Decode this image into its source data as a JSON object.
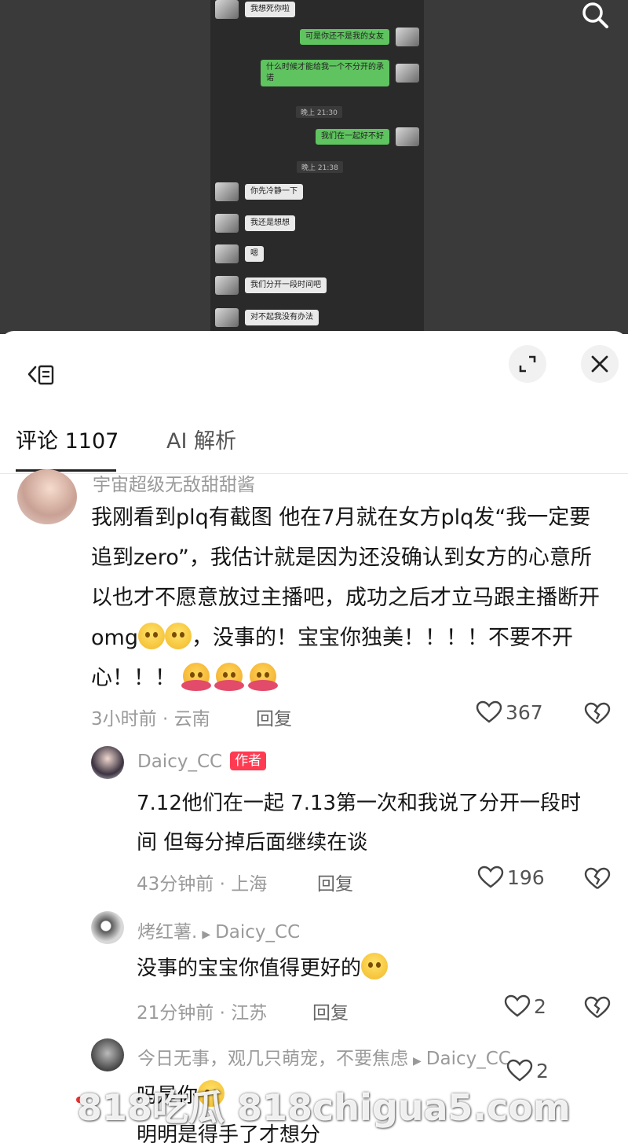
{
  "video": {
    "chat": [
      {
        "side": "left",
        "text": "我想死你啦"
      },
      {
        "side": "right",
        "text": "可是你还不是我的女友"
      },
      {
        "side": "right",
        "text": "什么时候才能给我一个不分开的承诺"
      },
      {
        "system": "晚上 21:30"
      },
      {
        "side": "right",
        "text": "我们在一起好不好"
      },
      {
        "system": "晚上 21:38"
      },
      {
        "side": "left",
        "text": "你先冷静一下"
      },
      {
        "side": "left",
        "text": "我还是想想"
      },
      {
        "side": "left",
        "text": "嗯"
      },
      {
        "side": "left",
        "text": "我们分开一段时间吧"
      },
      {
        "side": "left",
        "text": "对不起我没有办法"
      }
    ]
  },
  "header": {
    "tabs": [
      {
        "label": "评论 1107"
      },
      {
        "label": "AI 解析"
      }
    ]
  },
  "comments": [
    {
      "name": "宇宙超级无敌甜甜酱",
      "text": "我刚看到plq有截图 他在7月就在女方plq发“我一定要追到zero”，我估计就是因为还没确认到女方的心意所以也才不愿意放过主播吧，成功之后才立马跟主播断开omg",
      "text_tail1": "，没事的！宝宝你独美！！！！不要不开心！！！",
      "meta": "3小时前 · 云南",
      "reply": "回复",
      "likes": "367"
    },
    {
      "name": "Daicy_CC",
      "badge": "作者",
      "text": "7.12他们在一起 7.13第一次和我说了分开一段时间 但每分掉后面继续在谈",
      "meta": "43分钟前 · 上海",
      "reply": "回复",
      "likes": "196"
    },
    {
      "name": "烤红薯.",
      "reply_to": "Daicy_CC",
      "text": "没事的宝宝你值得更好的",
      "meta": "21分钟前 · 江苏",
      "reply": "回复",
      "likes": "2"
    },
    {
      "name": "今日无事，观几只萌宠，不要焦虑",
      "reply_to": "Daicy_CC",
      "text_prefix": "吗是你",
      "text": "明明是得手了才想分",
      "likes": "2"
    }
  ],
  "watermark": "818吃瓜 818chigua5.com"
}
